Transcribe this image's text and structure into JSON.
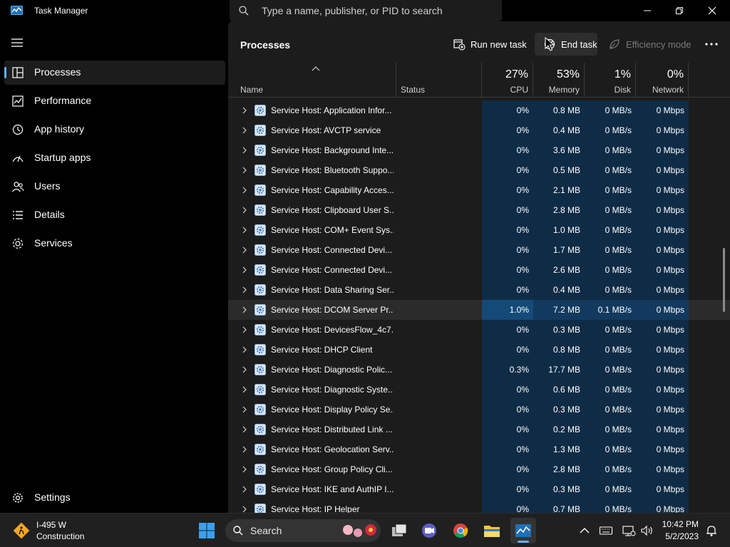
{
  "window": {
    "title": "Task Manager"
  },
  "search": {
    "placeholder": "Type a name, publisher, or PID to search"
  },
  "sidebar": {
    "items": [
      {
        "label": "Processes",
        "icon": "processes-icon",
        "active": true
      },
      {
        "label": "Performance",
        "icon": "performance-icon"
      },
      {
        "label": "App history",
        "icon": "app-history-icon"
      },
      {
        "label": "Startup apps",
        "icon": "startup-apps-icon"
      },
      {
        "label": "Users",
        "icon": "users-icon"
      },
      {
        "label": "Details",
        "icon": "details-icon"
      },
      {
        "label": "Services",
        "icon": "services-icon"
      }
    ],
    "settings": "Settings"
  },
  "main": {
    "title": "Processes",
    "toolbar": {
      "run_new_task": "Run new task",
      "end_task": "End task",
      "efficiency_mode": "Efficiency mode"
    },
    "columns": {
      "name": "Name",
      "status": "Status",
      "cpu_pct": "27%",
      "cpu": "CPU",
      "memory_pct": "53%",
      "memory": "Memory",
      "disk_pct": "1%",
      "disk": "Disk",
      "network_pct": "0%",
      "network": "Network"
    },
    "rows": [
      {
        "name": "Service Host: Application Infor...",
        "cpu": "0%",
        "memory": "0.8 MB",
        "disk": "0 MB/s",
        "network": "0 Mbps"
      },
      {
        "name": "Service Host: AVCTP service",
        "cpu": "0%",
        "memory": "0.4 MB",
        "disk": "0 MB/s",
        "network": "0 Mbps"
      },
      {
        "name": "Service Host: Background Inte...",
        "cpu": "0%",
        "memory": "3.6 MB",
        "disk": "0 MB/s",
        "network": "0 Mbps"
      },
      {
        "name": "Service Host: Bluetooth Suppo...",
        "cpu": "0%",
        "memory": "0.5 MB",
        "disk": "0 MB/s",
        "network": "0 Mbps"
      },
      {
        "name": "Service Host: Capability Acces...",
        "cpu": "0%",
        "memory": "2.1 MB",
        "disk": "0 MB/s",
        "network": "0 Mbps"
      },
      {
        "name": "Service Host: Clipboard User S...",
        "cpu": "0%",
        "memory": "2.8 MB",
        "disk": "0 MB/s",
        "network": "0 Mbps"
      },
      {
        "name": "Service Host: COM+ Event Sys...",
        "cpu": "0%",
        "memory": "1.0 MB",
        "disk": "0 MB/s",
        "network": "0 Mbps"
      },
      {
        "name": "Service Host: Connected Devi...",
        "cpu": "0%",
        "memory": "1.7 MB",
        "disk": "0 MB/s",
        "network": "0 Mbps"
      },
      {
        "name": "Service Host: Connected Devi...",
        "cpu": "0%",
        "memory": "2.6 MB",
        "disk": "0 MB/s",
        "network": "0 Mbps"
      },
      {
        "name": "Service Host: Data Sharing Ser...",
        "cpu": "0%",
        "memory": "0.4 MB",
        "disk": "0 MB/s",
        "network": "0 Mbps"
      },
      {
        "name": "Service Host: DCOM Server Pr...",
        "cpu": "1.0%",
        "memory": "7.2 MB",
        "disk": "0.1 MB/s",
        "network": "0 Mbps",
        "highlighted": true
      },
      {
        "name": "Service Host: DevicesFlow_4c7...",
        "cpu": "0%",
        "memory": "0.3 MB",
        "disk": "0 MB/s",
        "network": "0 Mbps"
      },
      {
        "name": "Service Host: DHCP Client",
        "cpu": "0%",
        "memory": "0.8 MB",
        "disk": "0 MB/s",
        "network": "0 Mbps"
      },
      {
        "name": "Service Host: Diagnostic Polic...",
        "cpu": "0.3%",
        "memory": "17.7 MB",
        "disk": "0 MB/s",
        "network": "0 Mbps"
      },
      {
        "name": "Service Host: Diagnostic Syste...",
        "cpu": "0%",
        "memory": "0.6 MB",
        "disk": "0 MB/s",
        "network": "0 Mbps"
      },
      {
        "name": "Service Host: Display Policy Se...",
        "cpu": "0%",
        "memory": "0.3 MB",
        "disk": "0 MB/s",
        "network": "0 Mbps"
      },
      {
        "name": "Service Host: Distributed Link ...",
        "cpu": "0%",
        "memory": "0.2 MB",
        "disk": "0 MB/s",
        "network": "0 Mbps"
      },
      {
        "name": "Service Host: Geolocation Serv...",
        "cpu": "0%",
        "memory": "1.3 MB",
        "disk": "0 MB/s",
        "network": "0 Mbps"
      },
      {
        "name": "Service Host: Group Policy Cli...",
        "cpu": "0%",
        "memory": "2.8 MB",
        "disk": "0 MB/s",
        "network": "0 Mbps"
      },
      {
        "name": "Service Host: IKE and AuthIP I...",
        "cpu": "0%",
        "memory": "0.3 MB",
        "disk": "0 MB/s",
        "network": "0 Mbps"
      },
      {
        "name": "Service Host: IP Helper",
        "cpu": "0%",
        "memory": "0.7 MB",
        "disk": "0 MB/s",
        "network": "0 Mbps"
      }
    ]
  },
  "taskbar": {
    "weather_line1": "I-495 W",
    "weather_line2": "Construction",
    "search_label": "Search",
    "time": "10:42 PM",
    "date": "5/2/2023",
    "apps": [
      "start-icon",
      "task-view-icon",
      "meet-icon",
      "chrome-icon",
      "file-explorer-icon",
      "task-manager-icon"
    ]
  },
  "colors": {
    "accent": "#5fb2f2",
    "column_bg": "#0f2c47",
    "highlight_cpu": "#144a78"
  }
}
